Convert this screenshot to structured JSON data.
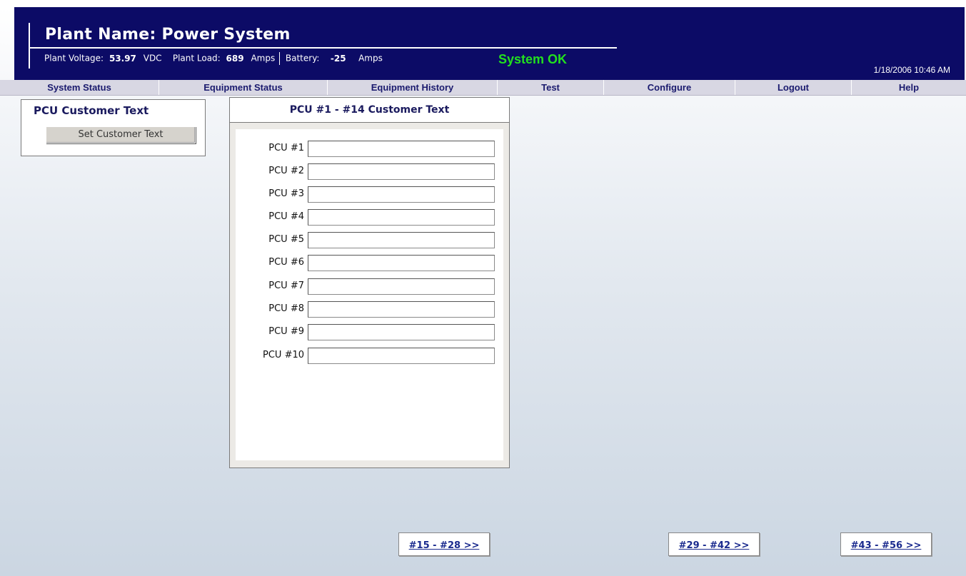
{
  "header": {
    "plant_name": "Plant Name:  Power System",
    "plant_voltage_label": "Plant Voltage:",
    "plant_voltage_value": "53.97",
    "plant_voltage_unit": "VDC",
    "plant_load_label": "Plant Load:",
    "plant_load_value": "689",
    "plant_load_unit": "Amps",
    "battery_label": "Battery:",
    "battery_value": "-25",
    "battery_unit": "Amps",
    "system_status": "System OK",
    "datetime": "1/18/2006 10:46 AM"
  },
  "nav": {
    "items": [
      {
        "label": "System Status"
      },
      {
        "label": "Equipment Status"
      },
      {
        "label": "Equipment History"
      },
      {
        "label": "Test"
      },
      {
        "label": "Configure"
      },
      {
        "label": "Logout"
      },
      {
        "label": "Help"
      }
    ]
  },
  "left_panel": {
    "title": "PCU Customer Text",
    "button_label": "Set Customer Text"
  },
  "center_panel": {
    "title": "PCU #1 - #14 Customer Text",
    "rows": [
      {
        "label": "PCU #1",
        "value": ""
      },
      {
        "label": "PCU #2",
        "value": ""
      },
      {
        "label": "PCU #3",
        "value": ""
      },
      {
        "label": "PCU #4",
        "value": ""
      },
      {
        "label": "PCU #5",
        "value": ""
      },
      {
        "label": "PCU #6",
        "value": ""
      },
      {
        "label": "PCU #7",
        "value": ""
      },
      {
        "label": "PCU #8",
        "value": ""
      },
      {
        "label": "PCU #9",
        "value": ""
      },
      {
        "label": "PCU #10",
        "value": ""
      }
    ]
  },
  "page_links": {
    "next_1": "#15 - #28 >>",
    "next_2": "#29 - #42 >>",
    "next_3": "#43 - #56 >>"
  },
  "colors": {
    "header_bg": "#0c0b66",
    "status_ok": "#22e01e",
    "nav_bg": "#d8d7e3",
    "nav_text": "#1a1a6e"
  }
}
